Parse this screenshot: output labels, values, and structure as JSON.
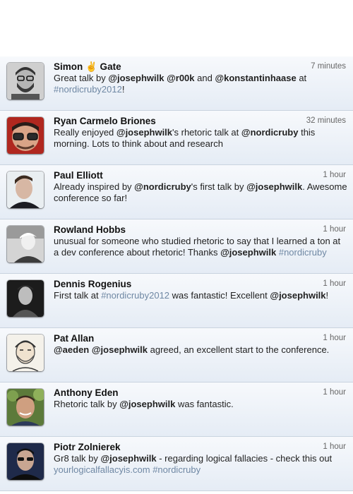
{
  "tweets": [
    {
      "name": "Simon ✌ Gate",
      "time": "7 minutes",
      "avatar_icon": "user-avatar-beard-glasses",
      "text": [
        {
          "t": "Great talk by ",
          "type": "plain"
        },
        {
          "t": "@josephwilk",
          "type": "mention"
        },
        {
          "t": " ",
          "type": "plain"
        },
        {
          "t": "@r00k",
          "type": "mention"
        },
        {
          "t": " and ",
          "type": "plain"
        },
        {
          "t": "@konstantinhaase",
          "type": "mention"
        },
        {
          "t": " at ",
          "type": "plain"
        },
        {
          "t": "#nordicruby2012",
          "type": "hashtag"
        },
        {
          "t": "!",
          "type": "plain"
        }
      ]
    },
    {
      "name": "Ryan Carmelo Briones",
      "time": "32 minutes",
      "avatar_icon": "user-avatar-glasses-red",
      "text": [
        {
          "t": "Really enjoyed ",
          "type": "plain"
        },
        {
          "t": "@josephwilk",
          "type": "mention"
        },
        {
          "t": "'s rhetoric talk at ",
          "type": "plain"
        },
        {
          "t": "@nordicruby",
          "type": "mention"
        },
        {
          "t": " this morning. Lots to think about and research",
          "type": "plain"
        }
      ]
    },
    {
      "name": "Paul Elliott",
      "time": "1 hour",
      "avatar_icon": "user-avatar-portrait",
      "text": [
        {
          "t": "Already inspired by ",
          "type": "plain"
        },
        {
          "t": "@nordicruby",
          "type": "mention"
        },
        {
          "t": "'s first talk by ",
          "type": "plain"
        },
        {
          "t": "@josephwilk",
          "type": "mention"
        },
        {
          "t": ". Awesome conference so far!",
          "type": "plain"
        }
      ]
    },
    {
      "name": "Rowland Hobbs",
      "time": "1 hour",
      "avatar_icon": "user-avatar-bw",
      "text": [
        {
          "t": "unusual for someone who studied rhetoric to say that I learned a ton at a dev conference about rhetoric! Thanks ",
          "type": "plain"
        },
        {
          "t": "@josephwilk",
          "type": "mention"
        },
        {
          "t": " ",
          "type": "plain"
        },
        {
          "t": "#nordicruby",
          "type": "hashtag"
        }
      ]
    },
    {
      "name": "Dennis Rogenius",
      "time": "1 hour",
      "avatar_icon": "user-avatar-dark",
      "text": [
        {
          "t": "First talk at ",
          "type": "plain"
        },
        {
          "t": "#nordicruby2012",
          "type": "hashtag"
        },
        {
          "t": " was fantastic! Excellent ",
          "type": "plain"
        },
        {
          "t": "@josephwilk",
          "type": "mention"
        },
        {
          "t": "!",
          "type": "plain"
        }
      ]
    },
    {
      "name": "Pat Allan",
      "time": "1 hour",
      "avatar_icon": "user-avatar-sketch",
      "text": [
        {
          "t": "@aeden",
          "type": "mention"
        },
        {
          "t": " ",
          "type": "plain"
        },
        {
          "t": "@josephwilk",
          "type": "mention"
        },
        {
          "t": " agreed, an excellent start to the conference.",
          "type": "plain"
        }
      ]
    },
    {
      "name": "Anthony Eden",
      "time": "1 hour",
      "avatar_icon": "user-avatar-outdoor",
      "text": [
        {
          "t": "Rhetoric talk by ",
          "type": "plain"
        },
        {
          "t": "@josephwilk",
          "type": "mention"
        },
        {
          "t": " was fantastic.",
          "type": "plain"
        }
      ]
    },
    {
      "name": "Piotr Zolnierek",
      "time": "1 hour",
      "avatar_icon": "user-avatar-blue",
      "text": [
        {
          "t": "Gr8 talk by ",
          "type": "plain"
        },
        {
          "t": "@josephwilk",
          "type": "mention"
        },
        {
          "t": " - regarding logical fallacies - check this out ",
          "type": "plain"
        },
        {
          "t": "yourlogicalfallacyis.com",
          "type": "link"
        },
        {
          "t": " ",
          "type": "plain"
        },
        {
          "t": "#nordicruby",
          "type": "hashtag"
        }
      ]
    }
  ]
}
